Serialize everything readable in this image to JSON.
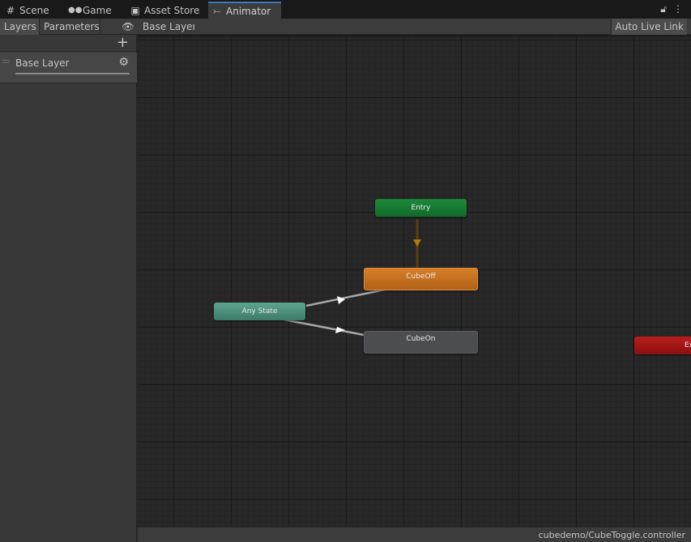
{
  "tabs": [
    {
      "label": "Scene",
      "icon": "grid-icon",
      "glyph": "#"
    },
    {
      "label": "Game",
      "icon": "gamepad-icon",
      "glyph": "🎮"
    },
    {
      "label": "Asset Store",
      "icon": "shopping-bag-icon",
      "glyph": "🛍"
    },
    {
      "label": "Animator",
      "icon": "animator-icon",
      "glyph": "⤚",
      "active": true
    }
  ],
  "window_controls": {
    "lock": "lock-icon",
    "menu": "kebab-menu-icon"
  },
  "toolbar": {
    "layers_label": "Layers",
    "parameters_label": "Parameters",
    "breadcrumb": "Base Layer",
    "auto_live_link": "Auto Live Link"
  },
  "left_panel": {
    "add_label": "+",
    "layers": [
      {
        "name": "Base Layer",
        "weight": 1.0
      }
    ]
  },
  "graph": {
    "states": [
      {
        "name": "Entry",
        "type": "entry",
        "color": "#1c8a3b"
      },
      {
        "name": "CubeOff",
        "type": "default-state",
        "color": "#d57f25"
      },
      {
        "name": "Any State",
        "type": "any-state",
        "color": "#5ea492"
      },
      {
        "name": "CubeOn",
        "type": "state",
        "color": "#4b4d51"
      },
      {
        "name": "Exit",
        "type": "exit",
        "color": "#b81d1d"
      }
    ],
    "transitions": [
      {
        "from": "Entry",
        "to": "CubeOff",
        "color": "#b1780a"
      },
      {
        "from": "Any State",
        "to": "CubeOff",
        "color": "#c8c8c8"
      },
      {
        "from": "Any State",
        "to": "CubeOn",
        "color": "#c8c8c8"
      }
    ]
  },
  "status": {
    "path": "cubedemo/CubeToggle.controller"
  }
}
